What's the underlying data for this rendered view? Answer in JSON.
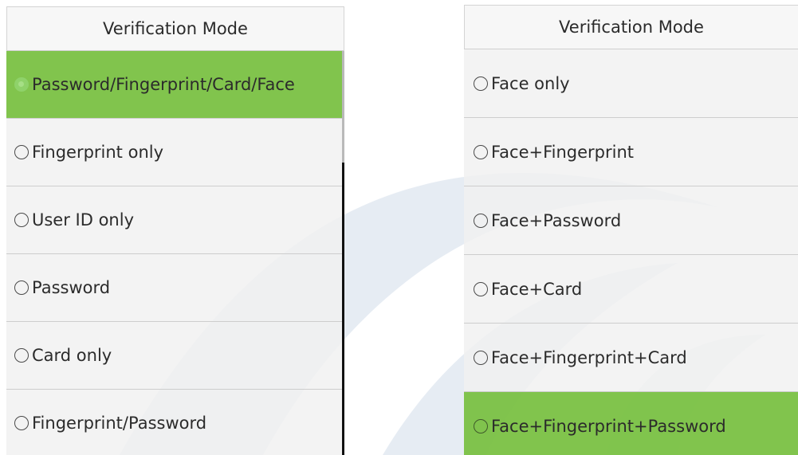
{
  "left_panel": {
    "title": "Verification Mode",
    "options": [
      {
        "label": "Password/Fingerprint/Card/Face",
        "selected": true
      },
      {
        "label": "Fingerprint only",
        "selected": false
      },
      {
        "label": "User ID only",
        "selected": false
      },
      {
        "label": "Password",
        "selected": false
      },
      {
        "label": "Card only",
        "selected": false
      },
      {
        "label": "Fingerprint/Password",
        "selected": false
      }
    ]
  },
  "right_panel": {
    "title": "Verification Mode",
    "options": [
      {
        "label": "Face only",
        "selected": false
      },
      {
        "label": "Face+Fingerprint",
        "selected": false
      },
      {
        "label": "Face+Password",
        "selected": false
      },
      {
        "label": "Face+Card",
        "selected": false
      },
      {
        "label": "Face+Fingerprint+Card",
        "selected": false
      },
      {
        "label": "Face+Fingerprint+Password",
        "selected": true
      }
    ]
  },
  "colors": {
    "selected_row": "#7ac143",
    "row_background": "#f0f0f0",
    "header_background": "#f6f6f6",
    "divider": "#cdcdcd",
    "text": "#2b2b2b",
    "watermark": "#dde6f0"
  },
  "icons": {
    "radio_unselected": "radio-circle-icon",
    "radio_selected": "radio-selected-icon"
  }
}
